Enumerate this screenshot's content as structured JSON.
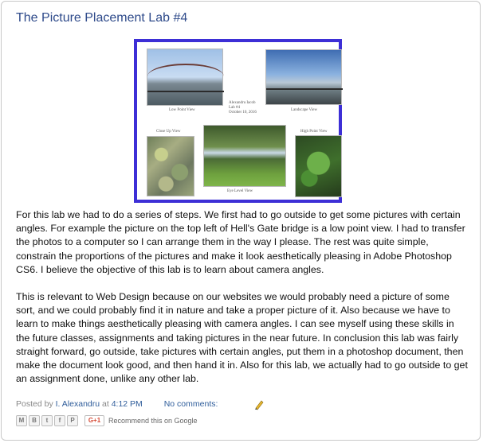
{
  "post": {
    "title": "The Picture Placement Lab #4",
    "figure": {
      "captions": {
        "low_point": "Low Point View",
        "landscape": "Landscape View",
        "close_up": "Close Up View",
        "eye_level": "Eye Level View",
        "high_point": "High Point View",
        "author_line1": "Alexandru Iacob",
        "author_line2": "Lab #4",
        "author_line3": "October 10, 2016"
      },
      "frame_color": "#3d2fd6"
    },
    "paragraphs": [
      "For this lab we had to do a series of steps. We first had to go outside to get some pictures with certain angles. For example the picture on the top left of Hell's Gate bridge is a low point view. I had to transfer the photos to a computer so I can arrange them in the way I please. The rest was quite simple, constrain the proportions of the pictures and make it look aesthetically pleasing in Adobe Photoshop CS6. I believe the objective of this lab is to learn about camera angles.",
      "This is relevant to Web Design because on our websites we would probably need a picture of some sort, and we could probably find it in nature and take a proper picture of it. Also because we have to learn to make things aesthetically pleasing with camera angles. I can see myself using these skills in the future classes, assignments and taking pictures in the near future. In conclusion this lab was fairly straight forward, go outside, take pictures with certain angles, put them in a photoshop document, then make the document look good, and then hand it in. Also for this lab, we actually had to go outside to get an assignment done, unlike any other lab."
    ],
    "footer": {
      "posted_by": "Posted by",
      "author": "I. Alexandru",
      "at": "at",
      "time": "4:12 PM",
      "comments": "No comments:",
      "edit_icon": "pencil-icon"
    },
    "share": {
      "buttons": [
        "email-icon",
        "blogger-icon",
        "twitter-icon",
        "facebook-icon",
        "pinterest-icon"
      ],
      "gplus_label": "G+1",
      "recommend": "Recommend this on Google"
    }
  }
}
